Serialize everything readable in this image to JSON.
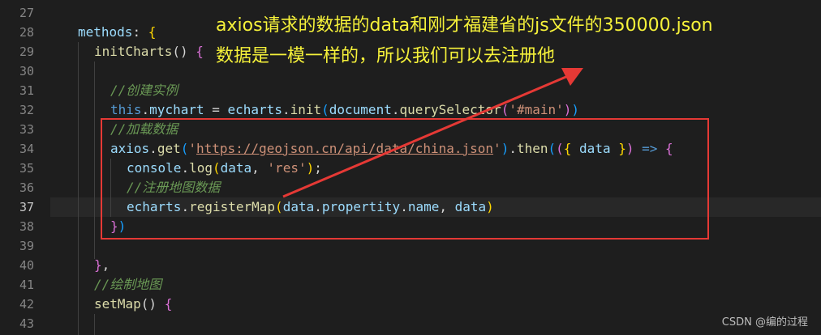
{
  "lines": [
    {
      "num": "27",
      "tokens": []
    },
    {
      "num": "28",
      "tokens": [
        {
          "t": "methods",
          "c": "t-prop"
        },
        {
          "t": ": ",
          "c": "t-punc"
        },
        {
          "t": "{",
          "c": "t-brace2"
        }
      ]
    },
    {
      "num": "29",
      "tokens": [
        {
          "t": "initCharts",
          "c": "t-func"
        },
        {
          "t": "() ",
          "c": "t-punc"
        },
        {
          "t": "{",
          "c": "t-brace"
        }
      ]
    },
    {
      "num": "30",
      "tokens": []
    },
    {
      "num": "31",
      "tokens": [
        {
          "t": "//创建实例",
          "c": "t-comment"
        }
      ]
    },
    {
      "num": "32",
      "tokens": [
        {
          "t": "this",
          "c": "t-key"
        },
        {
          "t": ".",
          "c": "t-punc"
        },
        {
          "t": "mychart",
          "c": "t-prop"
        },
        {
          "t": " = ",
          "c": "t-punc"
        },
        {
          "t": "echarts",
          "c": "t-prop"
        },
        {
          "t": ".",
          "c": "t-punc"
        },
        {
          "t": "init",
          "c": "t-func"
        },
        {
          "t": "(",
          "c": "t-brace3"
        },
        {
          "t": "document",
          "c": "t-prop"
        },
        {
          "t": ".",
          "c": "t-punc"
        },
        {
          "t": "querySelector",
          "c": "t-func"
        },
        {
          "t": "(",
          "c": "t-brace"
        },
        {
          "t": "'#main'",
          "c": "t-str"
        },
        {
          "t": ")",
          "c": "t-brace"
        },
        {
          "t": ")",
          "c": "t-brace3"
        }
      ]
    },
    {
      "num": "33",
      "tokens": [
        {
          "t": "//加载数据",
          "c": "t-comment"
        }
      ]
    },
    {
      "num": "34",
      "tokens": [
        {
          "t": "axios",
          "c": "t-prop"
        },
        {
          "t": ".",
          "c": "t-punc"
        },
        {
          "t": "get",
          "c": "t-func"
        },
        {
          "t": "(",
          "c": "t-brace3"
        },
        {
          "t": "'",
          "c": "t-str"
        },
        {
          "t": "https://geojson.cn/api/data/china.json",
          "c": "t-str-u"
        },
        {
          "t": "'",
          "c": "t-str"
        },
        {
          "t": ")",
          "c": "t-brace3"
        },
        {
          "t": ".",
          "c": "t-punc"
        },
        {
          "t": "then",
          "c": "t-func"
        },
        {
          "t": "(",
          "c": "t-brace3"
        },
        {
          "t": "(",
          "c": "t-brace"
        },
        {
          "t": "{ ",
          "c": "t-brace2"
        },
        {
          "t": "data",
          "c": "t-prop"
        },
        {
          "t": " }",
          "c": "t-brace2"
        },
        {
          "t": ")",
          "c": "t-brace"
        },
        {
          "t": " => ",
          "c": "t-key"
        },
        {
          "t": "{",
          "c": "t-brace"
        }
      ]
    },
    {
      "num": "35",
      "tokens": [
        {
          "t": "console",
          "c": "t-prop"
        },
        {
          "t": ".",
          "c": "t-punc"
        },
        {
          "t": "log",
          "c": "t-func"
        },
        {
          "t": "(",
          "c": "t-brace2"
        },
        {
          "t": "data",
          "c": "t-prop"
        },
        {
          "t": ", ",
          "c": "t-punc"
        },
        {
          "t": "'res'",
          "c": "t-str"
        },
        {
          "t": ")",
          "c": "t-brace2"
        },
        {
          "t": ";",
          "c": "t-punc"
        }
      ]
    },
    {
      "num": "36",
      "tokens": [
        {
          "t": "//注册地图数据",
          "c": "t-comment"
        }
      ]
    },
    {
      "num": "37",
      "tokens": [
        {
          "t": "echarts",
          "c": "t-prop"
        },
        {
          "t": ".",
          "c": "t-punc"
        },
        {
          "t": "registerMap",
          "c": "t-func"
        },
        {
          "t": "(",
          "c": "t-brace2"
        },
        {
          "t": "data",
          "c": "t-prop"
        },
        {
          "t": ".",
          "c": "t-punc"
        },
        {
          "t": "propertity",
          "c": "t-prop"
        },
        {
          "t": ".",
          "c": "t-punc"
        },
        {
          "t": "name",
          "c": "t-prop"
        },
        {
          "t": ", ",
          "c": "t-punc"
        },
        {
          "t": "data",
          "c": "t-prop"
        },
        {
          "t": ")",
          "c": "t-brace2"
        }
      ]
    },
    {
      "num": "38",
      "tokens": [
        {
          "t": "}",
          "c": "t-brace"
        },
        {
          "t": ")",
          "c": "t-brace3"
        }
      ]
    },
    {
      "num": "39",
      "tokens": []
    },
    {
      "num": "40",
      "tokens": [
        {
          "t": "}",
          "c": "t-brace"
        },
        {
          "t": ",",
          "c": "t-punc"
        }
      ]
    },
    {
      "num": "41",
      "tokens": [
        {
          "t": "//绘制地图",
          "c": "t-comment"
        }
      ]
    },
    {
      "num": "42",
      "tokens": [
        {
          "t": "setMap",
          "c": "t-func"
        },
        {
          "t": "() ",
          "c": "t-punc"
        },
        {
          "t": "{",
          "c": "t-brace"
        }
      ]
    },
    {
      "num": "43",
      "tokens": []
    }
  ],
  "active_line": "37",
  "annotation": {
    "line1": "axios请求的数据的data和刚才福建省的js文件的350000.json",
    "line2": "数据是一模一样的，所以我们可以去注册他"
  },
  "watermark": "CSDN @编的过程",
  "colors": {
    "annotation": "#f6f23a",
    "highlight_box": "#e53935",
    "arrow": "#e53935",
    "background": "#1e1e1e"
  }
}
